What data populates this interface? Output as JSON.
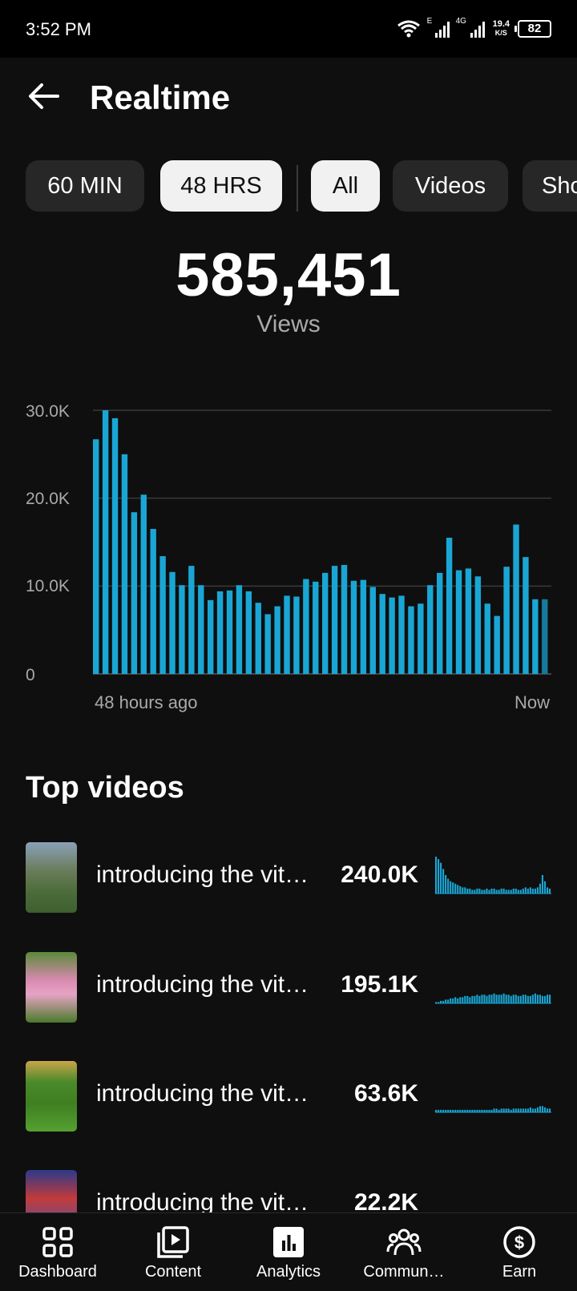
{
  "status": {
    "time": "3:52 PM",
    "net1": "E",
    "net2": "4G",
    "speed_value": "19.4",
    "speed_unit": "K/S",
    "battery": "82"
  },
  "header": {
    "title": "Realtime",
    "back_icon": "arrow-left-icon"
  },
  "chips": [
    {
      "label": "60 MIN",
      "selected": false
    },
    {
      "label": "48 HRS",
      "selected": true
    },
    {
      "label": "All",
      "selected": true
    },
    {
      "label": "Videos",
      "selected": false
    },
    {
      "label": "Shorts",
      "selected": false
    }
  ],
  "summary": {
    "total": "585,451",
    "metric": "Views"
  },
  "chart_data": {
    "type": "bar",
    "ylim": [
      0,
      30000
    ],
    "yticks": [
      "30.0K",
      "20.0K",
      "10.0K",
      "0"
    ],
    "x_start_label": "48 hours ago",
    "x_end_label": "Now",
    "values": [
      26700,
      30000,
      29100,
      25000,
      18400,
      20400,
      16500,
      13400,
      11600,
      10100,
      12300,
      10100,
      8400,
      9400,
      9500,
      10100,
      9400,
      8100,
      6800,
      7700,
      8900,
      8800,
      10800,
      10500,
      11500,
      12300,
      12400,
      10600,
      10700,
      9900,
      9100,
      8700,
      8900,
      7700,
      8000,
      10100,
      11500,
      15500,
      11800,
      12000,
      11100,
      8000,
      6600,
      12200,
      17000,
      13300,
      8500,
      8500
    ],
    "bar_color": "#1aa6d4",
    "last_bar_color": "#167a9c",
    "grid": true
  },
  "top_videos": {
    "title": "Top videos",
    "items": [
      {
        "title": "introducing the vit…",
        "views": "240.0K",
        "spark": [
          30,
          28,
          25,
          20,
          15,
          12,
          10,
          9,
          8,
          7,
          6,
          5,
          5,
          4,
          4,
          3,
          3,
          4,
          4,
          3,
          3,
          4,
          3,
          4,
          4,
          3,
          3,
          4,
          4,
          3,
          3,
          3,
          4,
          4,
          3,
          3,
          4,
          5,
          4,
          5,
          4,
          4,
          5,
          8,
          15,
          10,
          5,
          4
        ]
      },
      {
        "title": "introducing the vit…",
        "views": "195.1K",
        "spark": [
          1,
          1,
          2,
          2,
          3,
          3,
          4,
          4,
          5,
          4,
          5,
          5,
          6,
          6,
          5,
          6,
          6,
          7,
          6,
          7,
          7,
          6,
          7,
          7,
          8,
          7,
          7,
          7,
          8,
          7,
          7,
          6,
          7,
          7,
          6,
          6,
          7,
          7,
          6,
          6,
          7,
          8,
          7,
          7,
          6,
          6,
          7,
          7
        ]
      },
      {
        "title": "introducing the vit…",
        "views": "63.6K",
        "spark": [
          2,
          2,
          2,
          2,
          2,
          2,
          2,
          2,
          2,
          2,
          2,
          2,
          2,
          2,
          2,
          2,
          2,
          2,
          2,
          2,
          2,
          2,
          2,
          2,
          3,
          3,
          2,
          3,
          3,
          3,
          3,
          2,
          3,
          3,
          3,
          3,
          3,
          3,
          3,
          4,
          3,
          3,
          4,
          5,
          5,
          4,
          3,
          3
        ]
      },
      {
        "title": "introducing the vit…",
        "views": "22.2K",
        "spark": []
      }
    ]
  },
  "nav": [
    {
      "label": "Dashboard",
      "icon": "dashboard-icon"
    },
    {
      "label": "Content",
      "icon": "content-icon"
    },
    {
      "label": "Analytics",
      "icon": "analytics-icon",
      "active": true
    },
    {
      "label": "Commun…",
      "icon": "community-icon"
    },
    {
      "label": "Earn",
      "icon": "earn-icon"
    }
  ]
}
